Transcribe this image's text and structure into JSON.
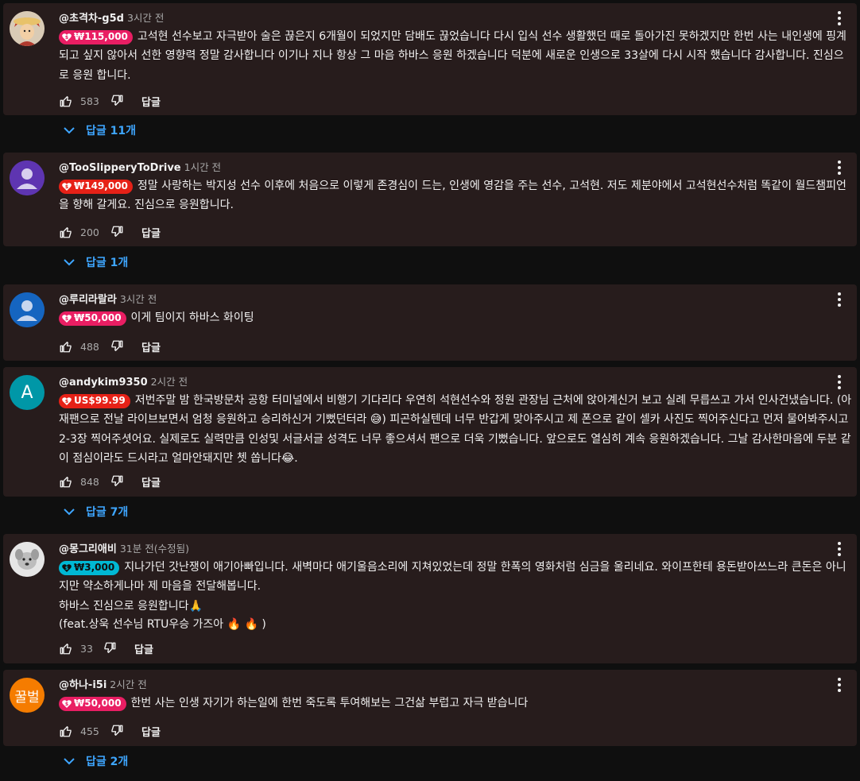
{
  "labels": {
    "reply": "답글"
  },
  "comments": [
    {
      "author": "@초격차-g5d",
      "time": "3시간 전",
      "amount": "₩115,000",
      "chip_color": "#e91e63",
      "text": "고석현 선수보고 자극받아 술은 끊은지 6개월이 되었지만 담배도 끊었습니다 다시 입식 선수 생활했던 때로 돌아가진 못하겠지만 한번 사는 내인생에 핑계 되고 싶지 않아서 선한 영향력 정말 감사합니다 이기나 지나 항상 그 마음 하바스 응원 하겠습니다 덕분에 새로운 인생으로 33살에 다시 시작 했습니다 감사합니다. 진심으로 응원 합니다.",
      "likes": "583",
      "replies": "답글 11개",
      "avatar_icon": "anime-character-avatar"
    },
    {
      "author": "@TooSlipperyToDrive",
      "time": "1시간 전",
      "amount": "₩149,000",
      "chip_color": "#e62117",
      "text": "정말 사랑하는 박지성 선수 이후에 처음으로 이렇게 존경심이 드는, 인생에 영감을 주는 선수, 고석현. 저도 제분야에서 고석현선수처럼 똑같이 월드챔피언을 향해 갈게요. 진심으로 응원합니다.",
      "likes": "200",
      "replies": "답글 1개",
      "avatar_color": "#5e35b1"
    },
    {
      "author": "@루리라랄라",
      "time": "3시간 전",
      "amount": "₩50,000",
      "chip_color": "#e91e63",
      "text": "이게 팀이지 하바스 화이팅",
      "likes": "488",
      "avatar_color": "#1565c0"
    },
    {
      "author": "@andykim9350",
      "time": "2시간 전",
      "amount": "US$99.99",
      "chip_color": "#e62117",
      "text_parts": [
        "저번주말 밤 한국방문차 공항 터미널에서 비행기 기다리다 우연히 석현선수와 정원 관장님 근처에 앉아계신거 보고 실례 무릅쓰고 가서 인사건냈습니다. (아재팬으로 전날 라이브보면서 엄청 응원하고 승리하신거 기뻤던터라 ",
        ") 피곤하실텐데 너무 반갑게 맞아주시고 제 폰으로 같이 셀카 사진도 찍어주신다고 먼저 물어봐주시고 2-3장 찍어주셧어요. 실제로도 실력만큼 인성및 서글서글 성격도 너무 좋으셔서 팬으로 더욱 기뻤습니다. 앞으로도 열심히 계속 응원하겠습니다. 그날 감사한마음에 두분 같이 점심이라도 드시라고 얼마안돼지만 쳇 쏩니다",
        "."
      ],
      "emoji_1": "😅",
      "emoji_2": "😂",
      "likes": "848",
      "replies": "답글 7개",
      "avatar_letter": "A",
      "avatar_color": "#0097a7"
    },
    {
      "author": "@몽그리애비",
      "time": "31분 전(수정됨)",
      "amount": "₩3,000",
      "chip_color": "#00b8d4",
      "text_lines": [
        "지나가던 갓난쟁이 애기아빠입니다. 새벽마다 애기울음소리에 지쳐있었는데 정말 한폭의 영화처럼 심금을 울리네요. 와이프한테 용돈받아쓰느라 큰돈은 아니지만 약소하게나마 제 마음을 전달해봅니다.",
        "하바스 진심으로 응원합니다",
        "(feat.상욱 선수님 RTU우승 가즈아"
      ],
      "emoji_pray": "🙏",
      "emoji_fire": "🔥 🔥",
      "close_paren": ")",
      "likes": "33",
      "avatar_icon": "dog-avatar"
    },
    {
      "author": "@하나-i5i",
      "time": "2시간 전",
      "amount": "₩50,000",
      "chip_color": "#e91e63",
      "text": "한번 사는 인생 자기가 하는일에 한번 죽도록 투여해보는 그건삶 부럽고 자극 받습니다",
      "likes": "455",
      "replies": "답글 2개",
      "avatar_letter": "꿀벌",
      "avatar_color": "#f57c00"
    }
  ]
}
